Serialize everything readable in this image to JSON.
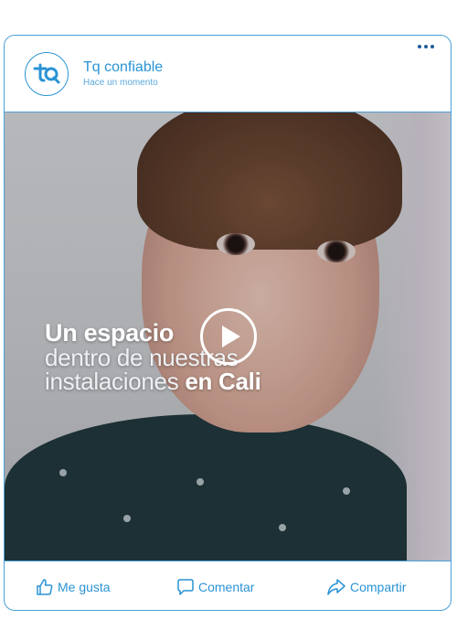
{
  "post": {
    "page_name": "Tq confiable",
    "time": "Hace un momento",
    "avatar_icon": "tq-logo-icon",
    "accent": "#2a93d4",
    "border": "#4aa0d6"
  },
  "media": {
    "type": "video",
    "overlay_line1": "Un espacio",
    "overlay_line2": "dentro de nuestras",
    "overlay_line3a": "instalaciones ",
    "overlay_line3b": "en Cali"
  },
  "actions": {
    "like": "Me gusta",
    "comment": "Comentar",
    "share": "Compartir"
  }
}
